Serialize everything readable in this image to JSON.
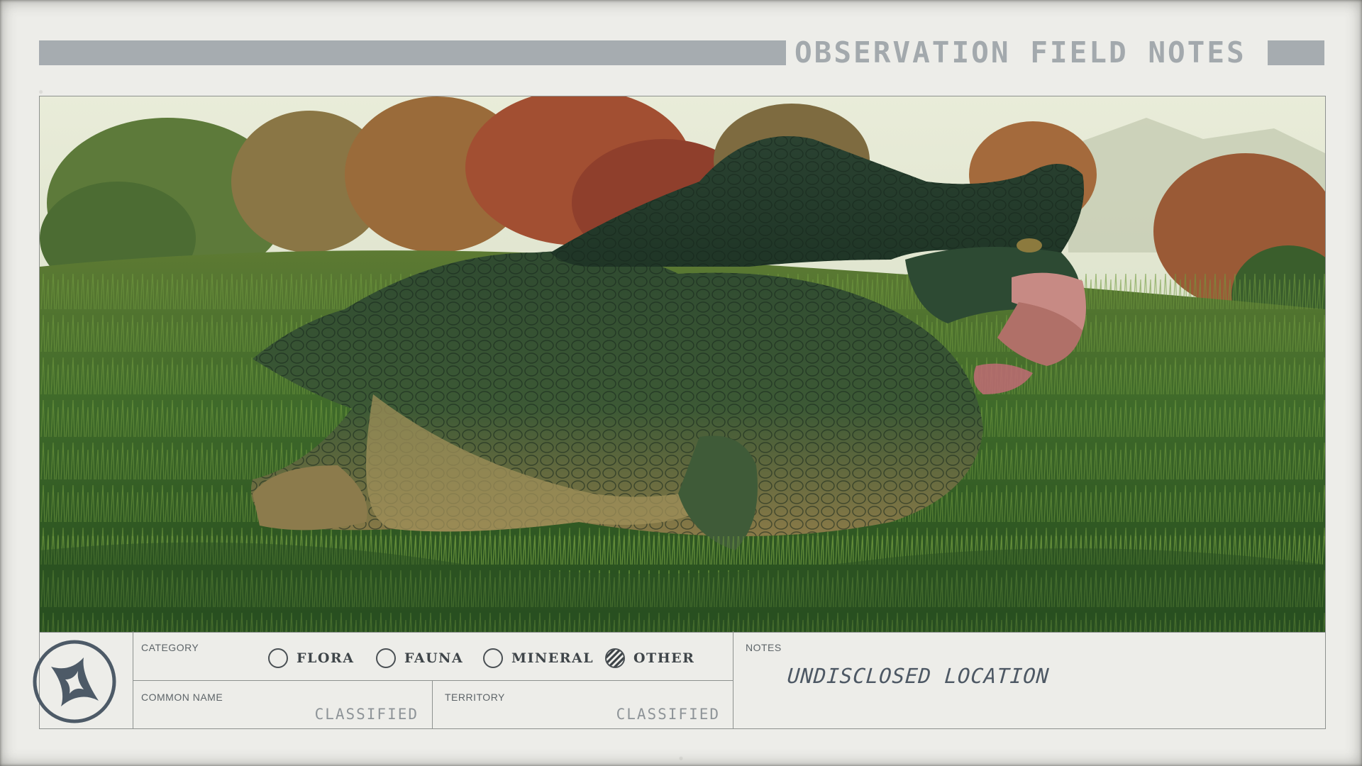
{
  "header": {
    "title": "OBSERVATION FIELD NOTES"
  },
  "photo": {
    "subject_icon": "creature-photo"
  },
  "emblem": {
    "icon": "constellation-star-icon"
  },
  "category": {
    "label": "CATEGORY",
    "options": [
      {
        "label": "FLORA",
        "checked": false
      },
      {
        "label": "FAUNA",
        "checked": false
      },
      {
        "label": "MINERAL",
        "checked": false
      },
      {
        "label": "OTHER",
        "checked": true
      }
    ]
  },
  "common_name": {
    "label": "COMMON NAME",
    "value": "CLASSIFIED"
  },
  "territory": {
    "label": "TERRITORY",
    "value": "CLASSIFIED"
  },
  "notes": {
    "label": "NOTES",
    "value": "UNDISCLOSED LOCATION"
  },
  "colors": {
    "paper": "#edede9",
    "header_bar": "#a6acb0",
    "ink": "#3f4549"
  }
}
